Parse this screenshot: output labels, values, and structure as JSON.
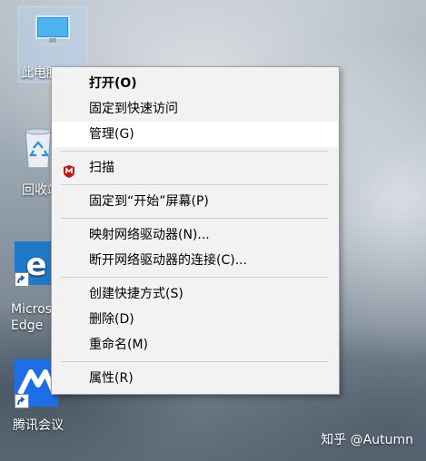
{
  "desktop": {
    "icons": [
      {
        "label": "此电脑",
        "icon": "computer-icon"
      },
      {
        "label": "回收站",
        "icon": "recycle-bin-icon"
      },
      {
        "label": "Microsoft Edge",
        "icon": "edge-icon"
      },
      {
        "label": "腾讯会议",
        "icon": "tencent-meeting-icon"
      }
    ],
    "watermark": "知乎 @Autumn"
  },
  "context_menu": {
    "open": "打开(O)",
    "pin_quick_access": "固定到快速访问",
    "manage": "管理(G)",
    "scan": "扫描",
    "scan_icon": "mcafee-icon",
    "pin_start": "固定到“开始”屏幕(P)",
    "map_drive": "映射网络驱动器(N)...",
    "disconnect_drive": "断开网络驱动器的连接(C)...",
    "create_shortcut": "创建快捷方式(S)",
    "delete": "删除(D)",
    "rename": "重命名(M)",
    "properties": "属性(R)"
  },
  "colors": {
    "menu_bg": "#f2f2f2",
    "menu_hover": "#ffffff",
    "mcafee_red": "#c01818",
    "edge_blue": "#1f78c8",
    "tencent_blue": "#1e6fe6"
  }
}
